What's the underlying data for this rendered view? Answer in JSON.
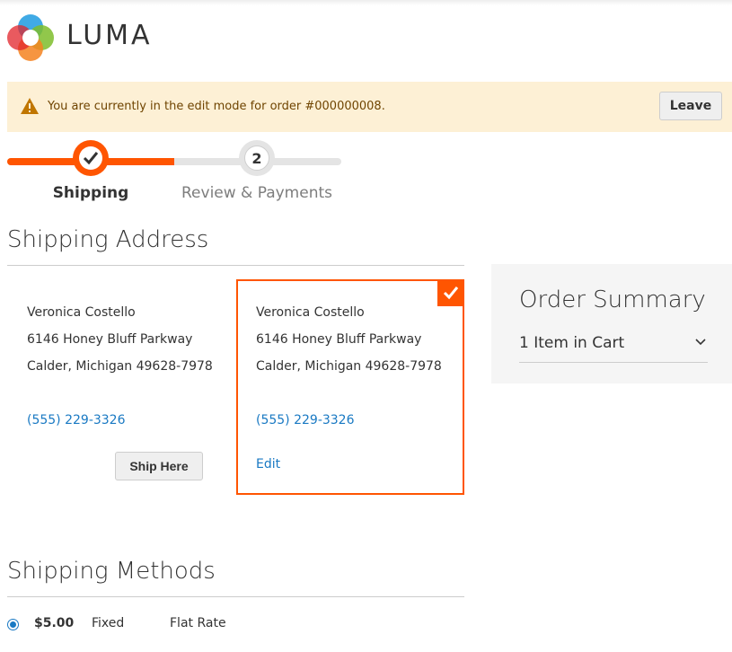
{
  "brand": {
    "name": "LUMA"
  },
  "notice": {
    "message": "You are currently in the edit mode for order #000000008.",
    "leave_label": "Leave"
  },
  "progress": {
    "steps": [
      {
        "number": "1",
        "label": "Shipping",
        "state": "complete"
      },
      {
        "number": "2",
        "label": "Review & Payments",
        "state": "pending"
      }
    ],
    "accent": "#ff5501"
  },
  "shipping_address": {
    "title": "Shipping Address",
    "addresses": [
      {
        "name": "Veronica Costello",
        "street": "6146 Honey Bluff Parkway",
        "city_line": "Calder, Michigan 49628-7978",
        "phone": "(555) 229-3326",
        "action_label": "Ship Here",
        "selected": false
      },
      {
        "name": "Veronica Costello",
        "street": "6146 Honey Bluff Parkway",
        "city_line": "Calder, Michigan 49628-7978",
        "phone": "(555) 229-3326",
        "action_label": "Edit",
        "selected": true
      }
    ]
  },
  "order_summary": {
    "title": "Order Summary",
    "items_label": "1 Item in Cart"
  },
  "shipping_methods": {
    "title": "Shipping Methods",
    "options": [
      {
        "price": "$5.00",
        "method": "Fixed",
        "carrier": "Flat Rate",
        "selected": true
      }
    ]
  },
  "colors": {
    "accent": "#ff5501",
    "link": "#1979c3",
    "notice_bg": "#fdf0d5"
  }
}
